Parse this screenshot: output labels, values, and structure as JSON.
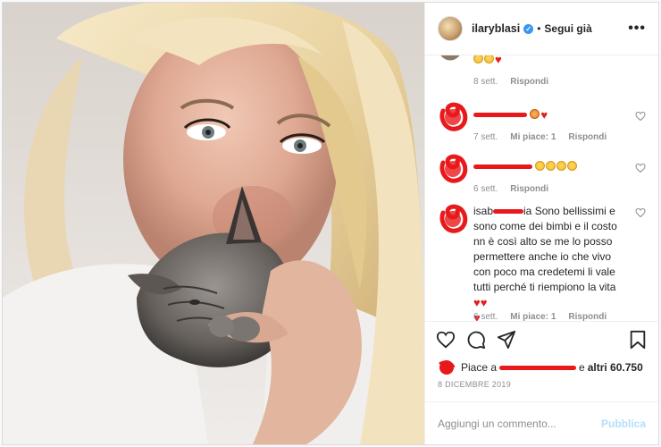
{
  "header": {
    "username": "ilaryblasi",
    "verified_symbol": "✓",
    "separator": "•",
    "follow_label": "Segui già",
    "more_label": "•••"
  },
  "comments": [
    {
      "id": "c0",
      "text": "",
      "emojis": [
        "laugh",
        "laugh",
        "heart"
      ],
      "time": "8 sett.",
      "likes": "",
      "reply_label": "Rispondi"
    },
    {
      "id": "c1",
      "text": "",
      "emojis": [
        "cat",
        "heart"
      ],
      "time": "7 sett.",
      "likes": "Mi piace: 1",
      "reply_label": "Rispondi"
    },
    {
      "id": "c2",
      "text": "",
      "emojis": [
        "laugh",
        "laugh",
        "laugh",
        "laugh"
      ],
      "time": "6 sett.",
      "likes": "",
      "reply_label": "Rispondi"
    },
    {
      "id": "c3",
      "author_visible": "isab",
      "author_suffix": "ia",
      "text": "Sono bellissimi e sono come dei bimbi e il costo nn è così alto se me lo posso permettere anche io che vivo con poco ma credetemi li vale tutti perché ti riempiono la vita",
      "emojis": [
        "heart",
        "heart",
        "heart"
      ],
      "time": "6 sett.",
      "likes": "Mi piace: 1",
      "reply_label": "Rispondi"
    }
  ],
  "actions": {
    "like": "heart-outline-icon",
    "comment": "comment-icon",
    "share": "share-icon",
    "save": "bookmark-icon"
  },
  "likes_line": {
    "prefix": "Piace a",
    "suffix": "e",
    "others": "altri 60.750"
  },
  "post_date": "8 DICEMBRE 2019",
  "add_comment": {
    "placeholder": "Aggiungi un commento...",
    "publish_label": "Pubblica"
  },
  "colors": {
    "accent_blue": "#3897f0",
    "publish_disabled": "#b2dffc",
    "redaction": "#e8191b",
    "heart": "#e0201d"
  }
}
